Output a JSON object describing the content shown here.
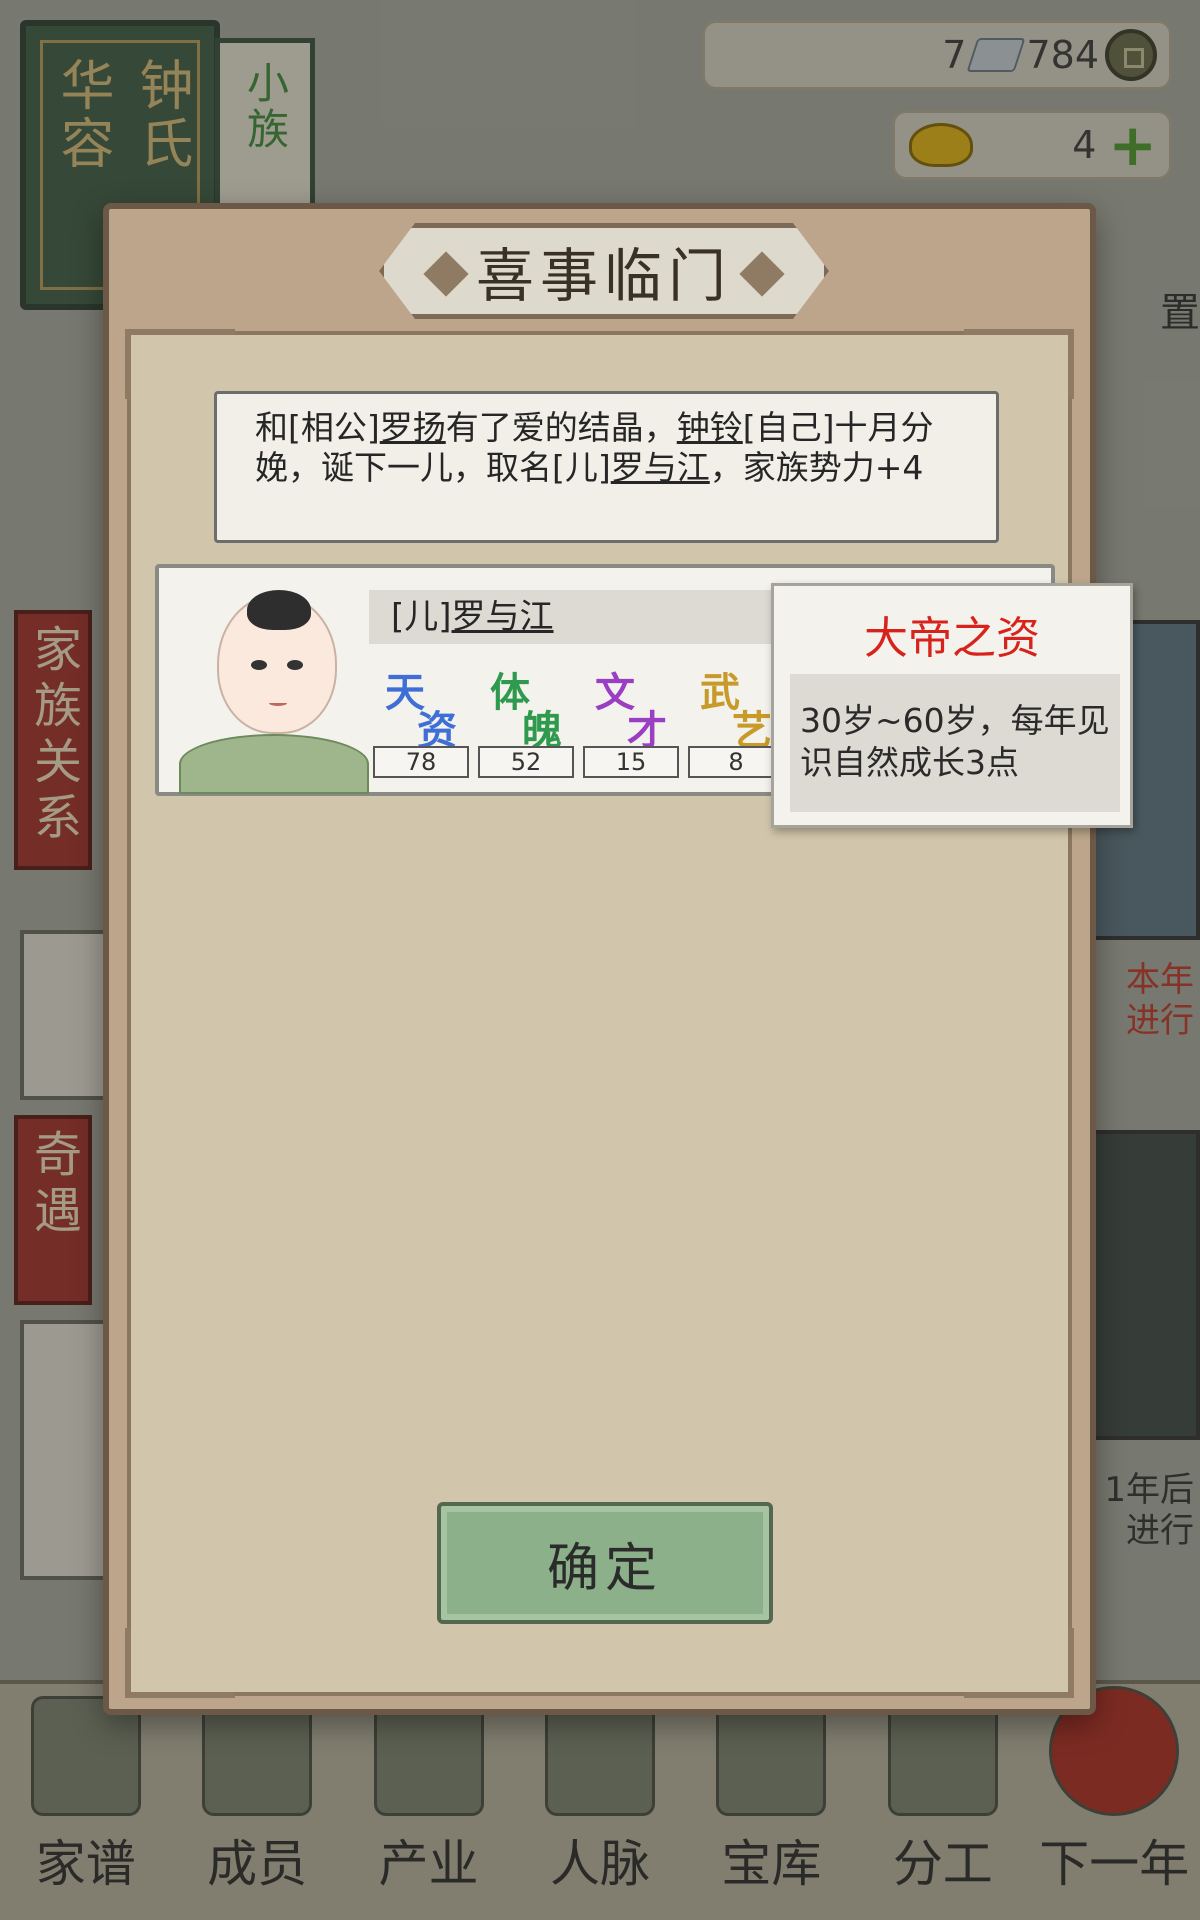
{
  "background": {
    "family_book": {
      "title_main": "华容",
      "title_sub": "钟氏"
    },
    "small_book": {
      "label": "小族"
    },
    "resources": {
      "silver": "7",
      "coins": "784",
      "gold": "4"
    },
    "settings_label": "置",
    "side_tabs": [
      "家族关系",
      "奇遇"
    ],
    "right_cards": [
      "本年进行",
      "1年后进行"
    ],
    "bottom_nav": [
      {
        "label": "家谱",
        "icon": "book-icon"
      },
      {
        "label": "成员",
        "icon": "person-icon"
      },
      {
        "label": "产业",
        "icon": "building-icon"
      },
      {
        "label": "人脉",
        "icon": "network-icon"
      },
      {
        "label": "宝库",
        "icon": "treasure-icon"
      },
      {
        "label": "分工",
        "icon": "scroll-icon"
      },
      {
        "label": "下一年",
        "icon": "spring-lantern-icon"
      }
    ]
  },
  "dialog": {
    "title": "喜事临门",
    "message": {
      "p1": "和[相公]",
      "husband": "罗扬",
      "p2": "有了爱的结晶，",
      "wife": "钟铃",
      "p3": "[自己]十月分娩，诞下一儿，取名[儿]",
      "child": "罗与江",
      "p4": "，家族势力+4"
    },
    "child": {
      "name_prefix": "[儿]",
      "name": "罗与江",
      "stats": [
        {
          "a": "天",
          "b": "资",
          "value": "78",
          "color": "#3f6fd6"
        },
        {
          "a": "体",
          "b": "魄",
          "value": "52",
          "color": "#2f9a4e"
        },
        {
          "a": "文",
          "b": "才",
          "value": "15",
          "color": "#9a3fc4"
        },
        {
          "a": "武",
          "b": "艺",
          "value": "8",
          "color": "#c79a2a"
        }
      ]
    },
    "tooltip": {
      "title": "大帝之资",
      "body": "30岁~60岁，每年见识自然成长3点"
    },
    "confirm_label": "确定"
  },
  "colors": {
    "tooltip_title": "#d8231d",
    "confirm_button": "#8cb08a",
    "dialog_frame": "#bca58a"
  }
}
